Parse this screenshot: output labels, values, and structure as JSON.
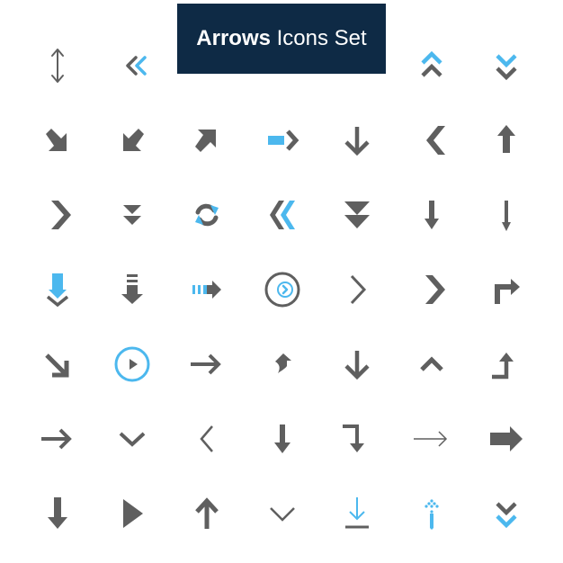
{
  "title": {
    "bold": "Arrows",
    "regular": "Icons Set"
  },
  "colors": {
    "gray": "#5f5f5f",
    "blue": "#4cb8ee",
    "banner": "#0e2a45"
  },
  "icons": [
    "double-vertical-arrow-icon",
    "double-chevron-left-icon",
    "",
    "",
    "",
    "double-chevron-up-icon",
    "double-chevron-down-icon",
    "arrow-down-right-icon",
    "arrow-down-left-icon",
    "arrow-up-right-icon",
    "blue-arrow-right-icon",
    "arrow-down-icon",
    "chevron-left-icon",
    "arrow-up-icon",
    "chevron-right-icon",
    "double-triangle-down-icon",
    "refresh-icon",
    "double-chevron-left-icon",
    "double-triangle-down-icon",
    "arrow-down-thick-icon",
    "arrow-down-thin-icon",
    "blue-arrow-down-icon",
    "striped-arrow-down-icon",
    "striped-arrow-right-icon",
    "circle-chevron-right-icon",
    "chevron-right-icon",
    "chevron-right-icon",
    "turn-right-arrow-icon",
    "arrow-down-right-icon",
    "play-circle-icon",
    "arrow-right-icon",
    "curved-arrow-up-icon",
    "arrow-down-icon",
    "chevron-up-icon",
    "turn-up-arrow-icon",
    "arrow-right-icon",
    "chevron-down-icon",
    "chevron-left-icon",
    "arrow-down-icon",
    "turn-down-arrow-icon",
    "arrow-right-thin-icon",
    "arrow-right-bold-icon",
    "arrow-down-icon",
    "play-triangle-icon",
    "arrow-up-icon",
    "chevron-down-icon",
    "download-icon",
    "dotted-arrow-up-icon",
    "double-chevron-down-icon"
  ]
}
